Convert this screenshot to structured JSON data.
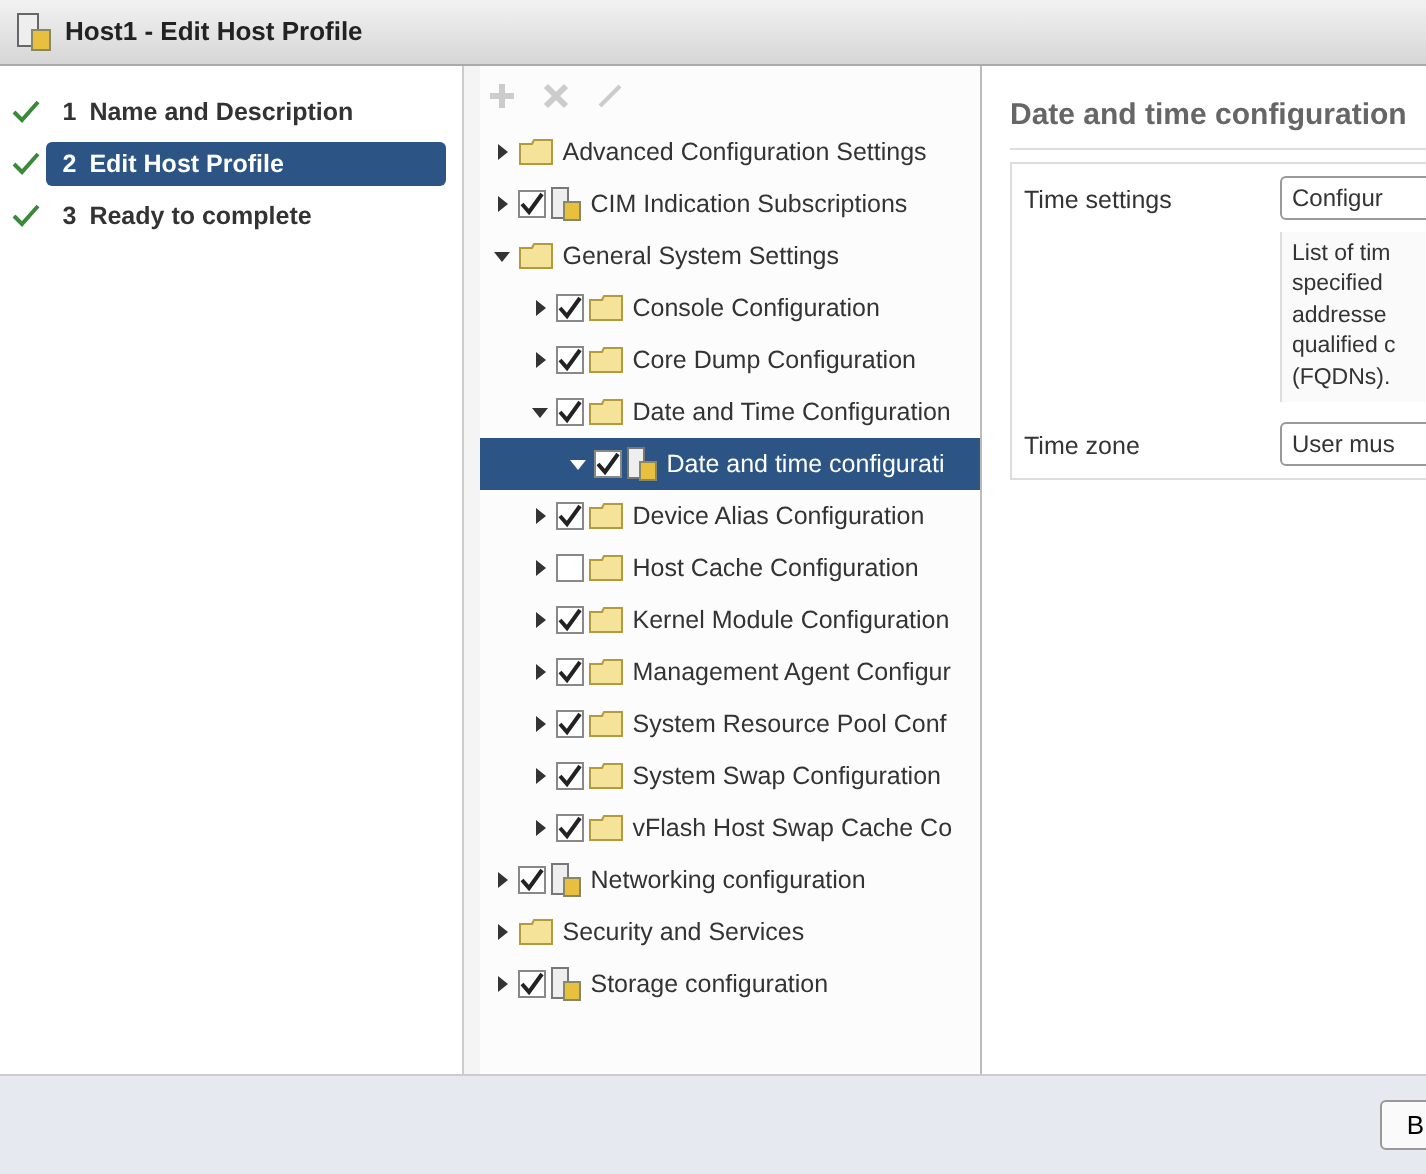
{
  "window": {
    "title": "Host1 - Edit Host Profile"
  },
  "steps": [
    {
      "number": "1",
      "label": "Name and Description",
      "done": true,
      "selected": false
    },
    {
      "number": "2",
      "label": "Edit Host Profile",
      "done": true,
      "selected": true
    },
    {
      "number": "3",
      "label": "Ready to complete",
      "done": true,
      "selected": false
    }
  ],
  "toolbar": [
    {
      "kind": "add",
      "disabled": true
    },
    {
      "kind": "remove",
      "disabled": true
    },
    {
      "kind": "edit",
      "disabled": true
    }
  ],
  "tree": [
    {
      "label": "Advanced Configuration Settings",
      "kind": "folder",
      "expanded": false,
      "selected": false
    },
    {
      "label": "CIM Indication Subscriptions",
      "kind": "profile",
      "checked": true,
      "expanded": false,
      "selected": false
    },
    {
      "label": "General System Settings",
      "kind": "folder",
      "expanded": true,
      "selected": false,
      "children": [
        {
          "label": "Console Configuration",
          "kind": "folder",
          "checked": true,
          "expanded": false,
          "selected": false
        },
        {
          "label": "Core Dump Configuration",
          "kind": "folder",
          "checked": true,
          "expanded": false,
          "selected": false
        },
        {
          "label": "Date and Time Configuration",
          "kind": "folder",
          "checked": true,
          "expanded": true,
          "selected": false,
          "children": [
            {
              "label": "Date and time configurati",
              "kind": "profile",
              "checked": true,
              "expanded": true,
              "selected": true
            }
          ]
        },
        {
          "label": "Device Alias Configuration",
          "kind": "folder",
          "checked": true,
          "expanded": false,
          "selected": false
        },
        {
          "label": "Host Cache Configuration",
          "kind": "folder",
          "checked": false,
          "expanded": false,
          "selected": false
        },
        {
          "label": "Kernel Module Configuration",
          "kind": "folder",
          "checked": true,
          "expanded": false,
          "selected": false
        },
        {
          "label": "Management Agent Configur",
          "kind": "folder",
          "checked": true,
          "expanded": false,
          "selected": false
        },
        {
          "label": "System Resource Pool Conf",
          "kind": "folder",
          "checked": true,
          "expanded": false,
          "selected": false
        },
        {
          "label": "System Swap Configuration",
          "kind": "folder",
          "checked": true,
          "expanded": false,
          "selected": false
        },
        {
          "label": "vFlash Host Swap Cache Co",
          "kind": "folder",
          "checked": true,
          "expanded": false,
          "selected": false
        }
      ]
    },
    {
      "label": "Networking configuration",
      "kind": "profile",
      "checked": true,
      "expanded": false,
      "selected": false
    },
    {
      "label": "Security and Services",
      "kind": "folder",
      "expanded": false,
      "selected": false
    },
    {
      "label": "Storage configuration",
      "kind": "profile",
      "checked": true,
      "expanded": false,
      "selected": false
    }
  ],
  "details": {
    "title": "Date and time configuration",
    "fields": [
      {
        "label": "Time settings",
        "value": "Configur",
        "description": [
          "List of tim",
          "specified",
          "addresse",
          "qualified c",
          "(FQDNs)."
        ]
      },
      {
        "label": "Time zone",
        "value": "User mus"
      }
    ]
  },
  "footer": {
    "buttons": [
      "B"
    ]
  }
}
